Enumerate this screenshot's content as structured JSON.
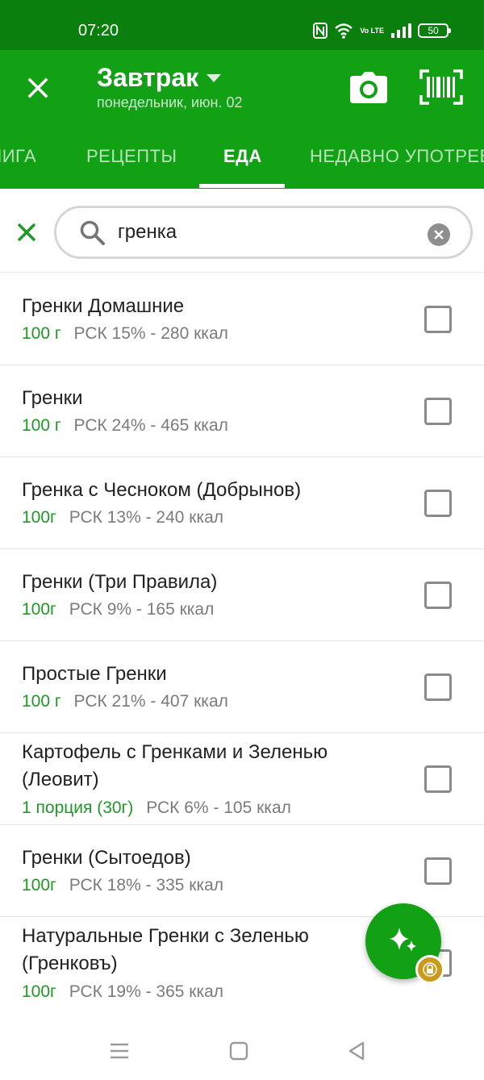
{
  "status_bar": {
    "time": "07:20",
    "battery_level": "50",
    "network_label": "Vo LTE",
    "icons": [
      "nfc-icon",
      "wifi-icon",
      "volte-icon",
      "signal-icon",
      "battery-icon"
    ]
  },
  "header": {
    "meal_title": "Завтрак",
    "date": "понедельник, июн. 02",
    "icons": [
      "close-icon",
      "dropdown-arrow-icon",
      "camera-icon",
      "barcode-icon"
    ]
  },
  "tabs": [
    {
      "label": "КНИГА"
    },
    {
      "label": "РЕЦЕПТЫ"
    },
    {
      "label": "ЕДА"
    },
    {
      "label": "НЕДАВНО УПОТРЕБЛЕННЫЕ"
    }
  ],
  "search": {
    "value": "гренка",
    "icons": [
      "close-icon",
      "search-icon",
      "clear-icon"
    ]
  },
  "results": [
    {
      "name": "Гренки Домашние",
      "name2": "",
      "qty": "100 г",
      "info": "РСК 15% - 280 ккал"
    },
    {
      "name": "Гренки",
      "name2": "",
      "qty": "100 г",
      "info": "РСК 24% - 465 ккал"
    },
    {
      "name": "Гренка с Чесноком (Добрынов)",
      "name2": "",
      "qty": "100г",
      "info": "РСК 13% - 240 ккал"
    },
    {
      "name": "Гренки (Три Правила)",
      "name2": "",
      "qty": "100г",
      "info": "РСК 9% - 165 ккал"
    },
    {
      "name": "Простые Гренки",
      "name2": "",
      "qty": "100 г",
      "info": "РСК 21% - 407 ккал"
    },
    {
      "name": "Картофель с Гренками и Зеленью",
      "name2": "(Леовит)",
      "qty": "1 порция (30г)",
      "info": "РСК 6% - 105 ккал"
    },
    {
      "name": "Гренки (Сытоедов)",
      "name2": "",
      "qty": "100г",
      "info": "РСК 18% - 335 ккал"
    },
    {
      "name": "Натуральные Гренки с Зеленью",
      "name2": "(Гренковъ)",
      "qty": "100г",
      "info": "РСК 19% - 365 ккал"
    }
  ],
  "fab": {
    "icons": [
      "sparkle-icon",
      "lock-icon"
    ]
  },
  "colors": {
    "primary": "#12a014",
    "status_bar": "#0b7f0e",
    "quantity": "#1c9a24",
    "badge": "#c99a1c"
  },
  "nav_bar": {
    "icons": [
      "menu-icon",
      "home-icon",
      "back-icon"
    ]
  }
}
